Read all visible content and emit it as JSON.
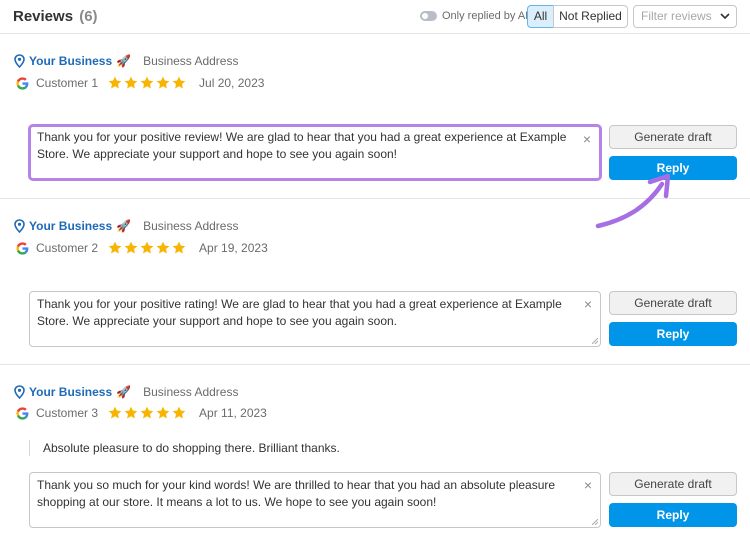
{
  "header": {
    "title": "Reviews",
    "count": "(6)",
    "toggle_label": "Only replied by AI",
    "seg_all": "All",
    "seg_not_replied": "Not Replied",
    "filter_placeholder": "Filter reviews"
  },
  "actions": {
    "generate_label": "Generate draft",
    "reply_label": "Reply",
    "clear_icon": "×"
  },
  "icons": {
    "pin": "location-pin-icon",
    "google": "google-logo-icon",
    "star": "star-icon",
    "rocket": "rocket-icon",
    "chevron": "chevron-down-icon"
  },
  "colors": {
    "accent": "#0095e9",
    "business_name": "#1f6ab8",
    "star": "#f7b500",
    "focus_border": "#b584e6"
  },
  "reviews": [
    {
      "business_name": "Your Business",
      "rocket": "🚀",
      "business_address": "Business Address",
      "customer": "Customer 1",
      "rating": 5,
      "date": "Jul 20, 2023",
      "comment": "",
      "reply_text": "Thank you for your positive review! We are glad to hear that you had a great experience at Example Store. We appreciate your support and hope to see you again soon!"
    },
    {
      "business_name": "Your Business",
      "rocket": "🚀",
      "business_address": "Business Address",
      "customer": "Customer 2",
      "rating": 5,
      "date": "Apr 19, 2023",
      "comment": "",
      "reply_text": "Thank you for your positive rating! We are glad to hear that you had a great experience at Example Store. We appreciate your support and hope to see you again soon."
    },
    {
      "business_name": "Your Business",
      "rocket": "🚀",
      "business_address": "Business Address",
      "customer": "Customer 3",
      "rating": 5,
      "date": "Apr 11, 2023",
      "comment": "Absolute pleasure to do shopping there. Brilliant thanks.",
      "reply_text": "Thank you so much for your kind words! We are thrilled to hear that you had an absolute pleasure shopping at our store. It means a lot to us. We hope to see you again soon!"
    }
  ]
}
